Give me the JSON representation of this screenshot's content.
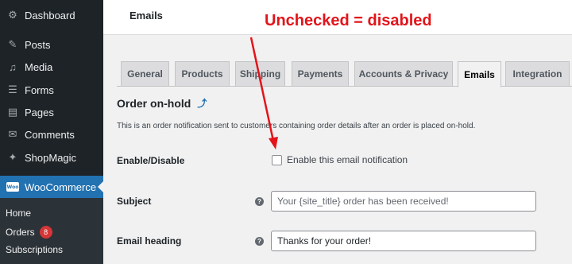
{
  "sidebar": {
    "items": [
      {
        "label": "Dashboard",
        "icon": "dashboard-icon",
        "glyph": "⚙"
      },
      {
        "label": "Posts",
        "icon": "pin-icon",
        "glyph": "✎"
      },
      {
        "label": "Media",
        "icon": "media-icon",
        "glyph": "♫"
      },
      {
        "label": "Forms",
        "icon": "forms-icon",
        "glyph": "☰"
      },
      {
        "label": "Pages",
        "icon": "pages-icon",
        "glyph": "▤"
      },
      {
        "label": "Comments",
        "icon": "comment-icon",
        "glyph": "✉"
      },
      {
        "label": "ShopMagic",
        "icon": "magic-wand-icon",
        "glyph": "✦"
      },
      {
        "label": "WooCommerce",
        "icon": "woocommerce-icon",
        "glyph": "Woo"
      }
    ],
    "submenu": [
      {
        "label": "Home"
      },
      {
        "label": "Orders",
        "badge": "8"
      },
      {
        "label": "Subscriptions"
      }
    ]
  },
  "header": {
    "title": "Emails"
  },
  "annotation": {
    "text": "Unchecked = disabled",
    "color": "#e3141a"
  },
  "tabs": [
    {
      "label": "General"
    },
    {
      "label": "Products"
    },
    {
      "label": "Shipping"
    },
    {
      "label": "Payments"
    },
    {
      "label": "Accounts & Privacy"
    },
    {
      "label": "Emails",
      "active": true
    },
    {
      "label": "Integration"
    }
  ],
  "section": {
    "title": "Order on-hold",
    "description": "This is an order notification sent to customers containing order details after an order is placed on-hold."
  },
  "form": {
    "enable": {
      "label": "Enable/Disable",
      "checkbox_label": "Enable this email notification",
      "checked": false
    },
    "subject": {
      "label": "Subject",
      "placeholder": "Your {site_title} order has been received!",
      "value": ""
    },
    "heading": {
      "label": "Email heading",
      "value": "Thanks for your order!"
    }
  },
  "colors": {
    "accent": "#2271b1",
    "sidebar": "#1d2327",
    "badge": "#d63638"
  }
}
